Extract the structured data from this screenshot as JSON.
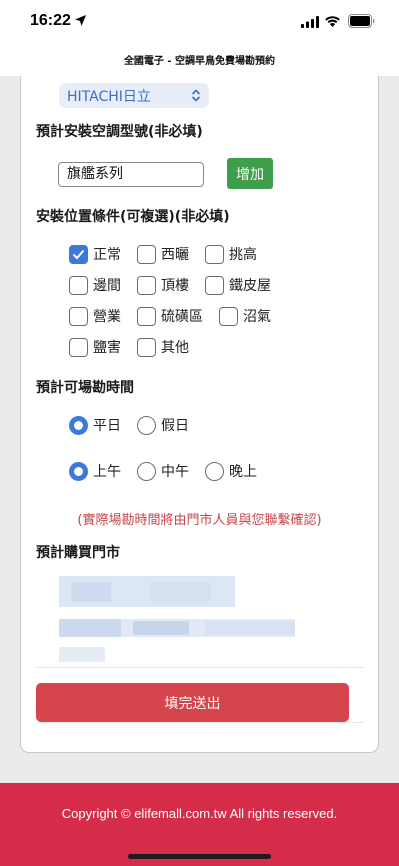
{
  "status_bar": {
    "time": "16:22"
  },
  "page": {
    "title": "全國電子 - 空調早鳥免費場勘預約"
  },
  "brand_select": {
    "value": "HITACHI日立"
  },
  "model_section": {
    "label": "預計安裝空調型號(非必填)",
    "input_value": "旗艦系列",
    "add_button_label": "增加"
  },
  "location_section": {
    "label": "安裝位置條件(可複選)(非必填)",
    "options": [
      {
        "label": "正常",
        "checked": true
      },
      {
        "label": "西曬",
        "checked": false
      },
      {
        "label": "挑高",
        "checked": false
      },
      {
        "label": "邊間",
        "checked": false
      },
      {
        "label": "頂樓",
        "checked": false
      },
      {
        "label": "鐵皮屋",
        "checked": false
      },
      {
        "label": "營業",
        "checked": false
      },
      {
        "label": "硫磺區",
        "checked": false
      },
      {
        "label": "沼氣",
        "checked": false
      },
      {
        "label": "鹽害",
        "checked": false
      },
      {
        "label": "其他",
        "checked": false
      }
    ]
  },
  "time_section": {
    "label": "預計可場勘時間",
    "day_options": [
      {
        "label": "平日",
        "checked": true
      },
      {
        "label": "假日",
        "checked": false
      }
    ],
    "period_options": [
      {
        "label": "上午",
        "checked": true
      },
      {
        "label": "中午",
        "checked": false
      },
      {
        "label": "晚上",
        "checked": false
      }
    ]
  },
  "notice": "(實際場勘時間將由門市人員與您聯繫確認)",
  "store_section": {
    "label": "預計購買門市"
  },
  "submit_button_label": "填完送出",
  "footer": {
    "copyright": "Copyright © elifemall.com.tw All rights reserved."
  },
  "colors": {
    "accent_blue": "#3b7ad9",
    "add_green": "#3f9e4b",
    "submit_red": "#d4454c",
    "footer_red": "#d52c4a",
    "notice_red": "#c8454b"
  }
}
